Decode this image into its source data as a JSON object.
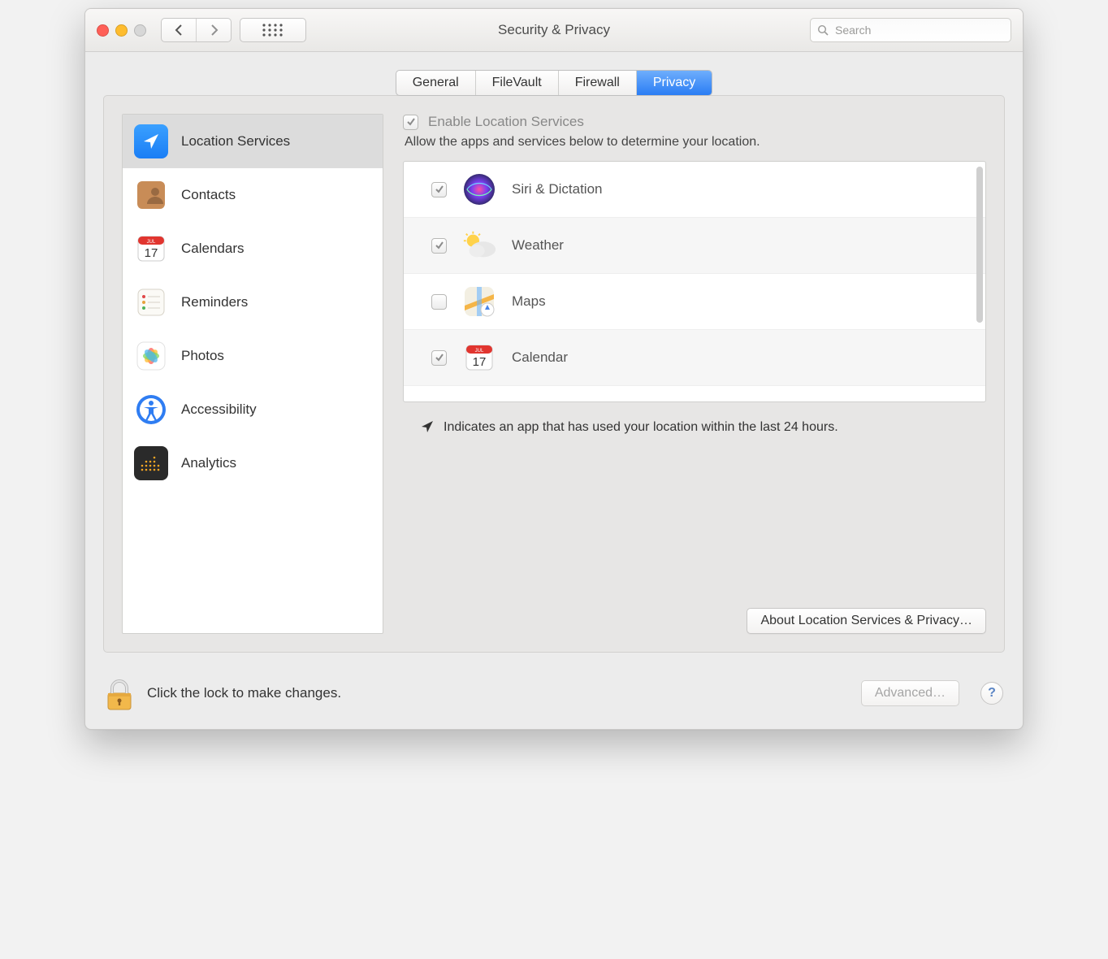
{
  "window": {
    "title": "Security & Privacy",
    "search_placeholder": "Search"
  },
  "tabs": [
    {
      "label": "General",
      "active": false
    },
    {
      "label": "FileVault",
      "active": false
    },
    {
      "label": "Firewall",
      "active": false
    },
    {
      "label": "Privacy",
      "active": true
    }
  ],
  "sidebar": {
    "items": [
      {
        "label": "Location Services",
        "icon": "location",
        "selected": true
      },
      {
        "label": "Contacts",
        "icon": "contacts",
        "selected": false
      },
      {
        "label": "Calendars",
        "icon": "calendar",
        "selected": false
      },
      {
        "label": "Reminders",
        "icon": "reminders",
        "selected": false
      },
      {
        "label": "Photos",
        "icon": "photos",
        "selected": false
      },
      {
        "label": "Accessibility",
        "icon": "accessibility",
        "selected": false
      },
      {
        "label": "Analytics",
        "icon": "analytics",
        "selected": false
      }
    ]
  },
  "privacy": {
    "enable_checkbox_checked": true,
    "enable_label": "Enable Location Services",
    "allow_text": "Allow the apps and services below to determine your location.",
    "apps": [
      {
        "label": "Siri & Dictation",
        "icon": "siri",
        "checked": true
      },
      {
        "label": "Weather",
        "icon": "weather",
        "checked": true
      },
      {
        "label": "Maps",
        "icon": "maps",
        "checked": false
      },
      {
        "label": "Calendar",
        "icon": "calendar",
        "checked": true
      }
    ],
    "indicator_text": "Indicates an app that has used your location within the last 24 hours.",
    "about_button": "About Location Services & Privacy…"
  },
  "footer": {
    "lock_text": "Click the lock to make changes.",
    "advanced_button": "Advanced…",
    "help": "?"
  }
}
